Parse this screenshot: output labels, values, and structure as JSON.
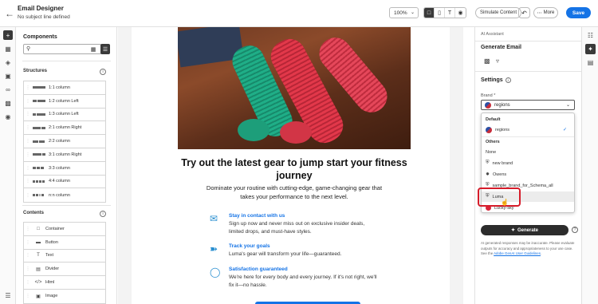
{
  "header": {
    "back_icon": "arrow-left-icon",
    "title": "Email Designer",
    "subtitle": "No subject line defined",
    "zoom": "100%",
    "simulate_label": "Simulate Content",
    "more_label": "More",
    "save_label": "Save",
    "accent": "#1473e6"
  },
  "components": {
    "title": "Components",
    "search_placeholder": "",
    "structures_label": "Structures",
    "contents_label": "Contents",
    "structures": [
      {
        "label": "1:1 column"
      },
      {
        "label": "1:2 column Left"
      },
      {
        "label": "1:3 column Left"
      },
      {
        "label": "2:1 column Right"
      },
      {
        "label": "2:2 column"
      },
      {
        "label": "3:1 column Right"
      },
      {
        "label": "3:3 column"
      },
      {
        "label": "4:4 column"
      },
      {
        "label": "n:n column"
      }
    ],
    "contents": [
      {
        "label": "Container",
        "icon": "container-icon"
      },
      {
        "label": "Button",
        "icon": "button-icon"
      },
      {
        "label": "Text",
        "icon": "text-icon"
      },
      {
        "label": "Divider",
        "icon": "divider-icon"
      },
      {
        "label": "Html",
        "icon": "code-icon"
      },
      {
        "label": "Image",
        "icon": "image-icon"
      }
    ]
  },
  "email": {
    "headline": "Try out the latest gear to jump start your fitness journey",
    "lead": "Dominate your routine with cutting-edge, game-changing gear that takes your performance to the next level.",
    "features": [
      {
        "title": "Stay in contact with us",
        "desc": "Sign up now and never miss out on exclusive insider deals, limited drops, and must-have styles.",
        "icon": "mail-icon"
      },
      {
        "title": "Track your goals",
        "desc": "Luma's gear will transform your life—guaranteed.",
        "icon": "running-icon"
      },
      {
        "title": "Satisfaction guaranteed",
        "desc": "We're here for every body and every journey. If it's not right, we'll fix it—no hassle.",
        "icon": "shield-check-icon"
      }
    ]
  },
  "ai": {
    "header": "AI Assistant",
    "title": "Generate Email",
    "settings_label": "Settings",
    "brand_label": "Brand",
    "brand_value": "regions",
    "generate_label": "Generate",
    "disclaimer": "AI generated responses may be inaccurate. Please evaluate outputs for accuracy and appropriateness to your use case. See the ",
    "disclaimer_link": "Adobe GenAI User Guidelines",
    "disclaimer_end": "."
  },
  "dropdown": {
    "default_label": "Default",
    "default_item": "regions",
    "others_label": "Others",
    "items": [
      "None",
      "new brand",
      "Owens",
      "sample_brand_for_Schema_all",
      "Luma",
      "Lucky-sky"
    ],
    "selected": "regions",
    "hovered": "Luma"
  }
}
